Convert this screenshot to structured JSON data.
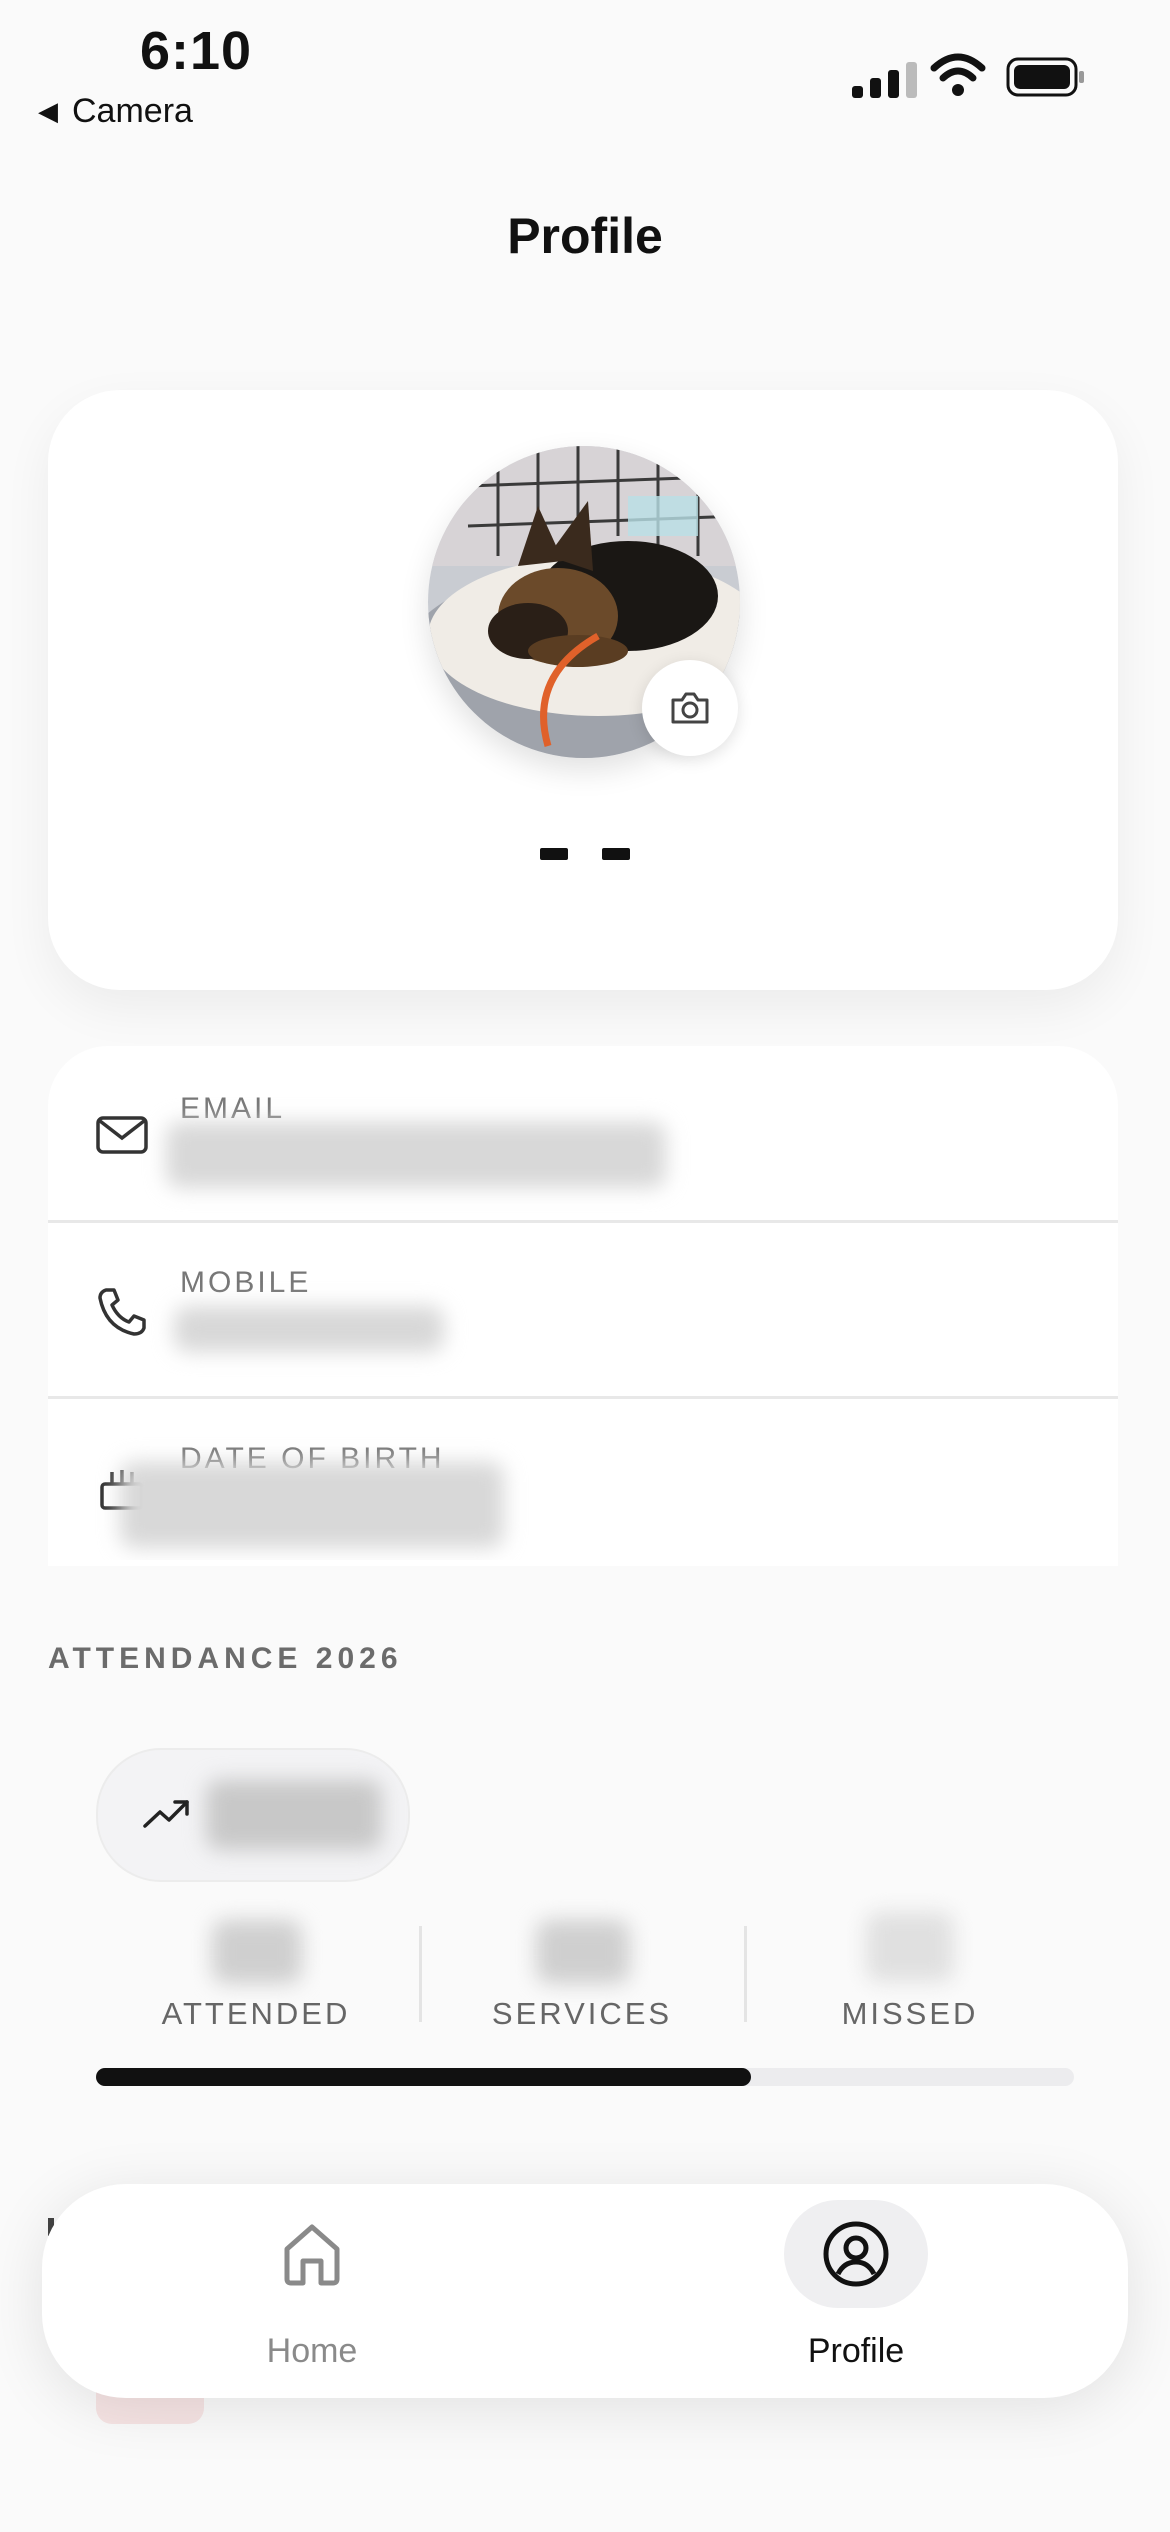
{
  "status_bar": {
    "time": "6:10",
    "back_label": "Camera",
    "icons": [
      "cellular-signal-icon",
      "wifi-icon",
      "battery-icon"
    ]
  },
  "header": {
    "title": "Profile"
  },
  "profile": {
    "avatar_alt": "dog-photo",
    "name_placeholder": "- -",
    "camera_icon": "camera-icon"
  },
  "info": {
    "email": {
      "label": "EMAIL",
      "icon": "mail-icon"
    },
    "mobile": {
      "label": "MOBILE",
      "icon": "phone-icon"
    },
    "dob": {
      "label": "DATE OF BIRTH",
      "icon": "cake-icon"
    }
  },
  "attendance": {
    "title": "ATTENDANCE 2026",
    "trend_icon": "trending-up-icon",
    "stats": [
      {
        "label": "ATTENDED"
      },
      {
        "label": "SERVICES"
      },
      {
        "label": "MISSED"
      }
    ],
    "progress_fraction": 0.67
  },
  "tabbar": {
    "tabs": [
      {
        "label": "Home",
        "icon": "home-icon",
        "active": false
      },
      {
        "label": "Profile",
        "icon": "user-circle-icon",
        "active": true
      }
    ]
  },
  "colors": {
    "text": "#111111",
    "muted": "#777777",
    "background": "#fafafa",
    "card": "#ffffff",
    "progress": "#111111"
  }
}
